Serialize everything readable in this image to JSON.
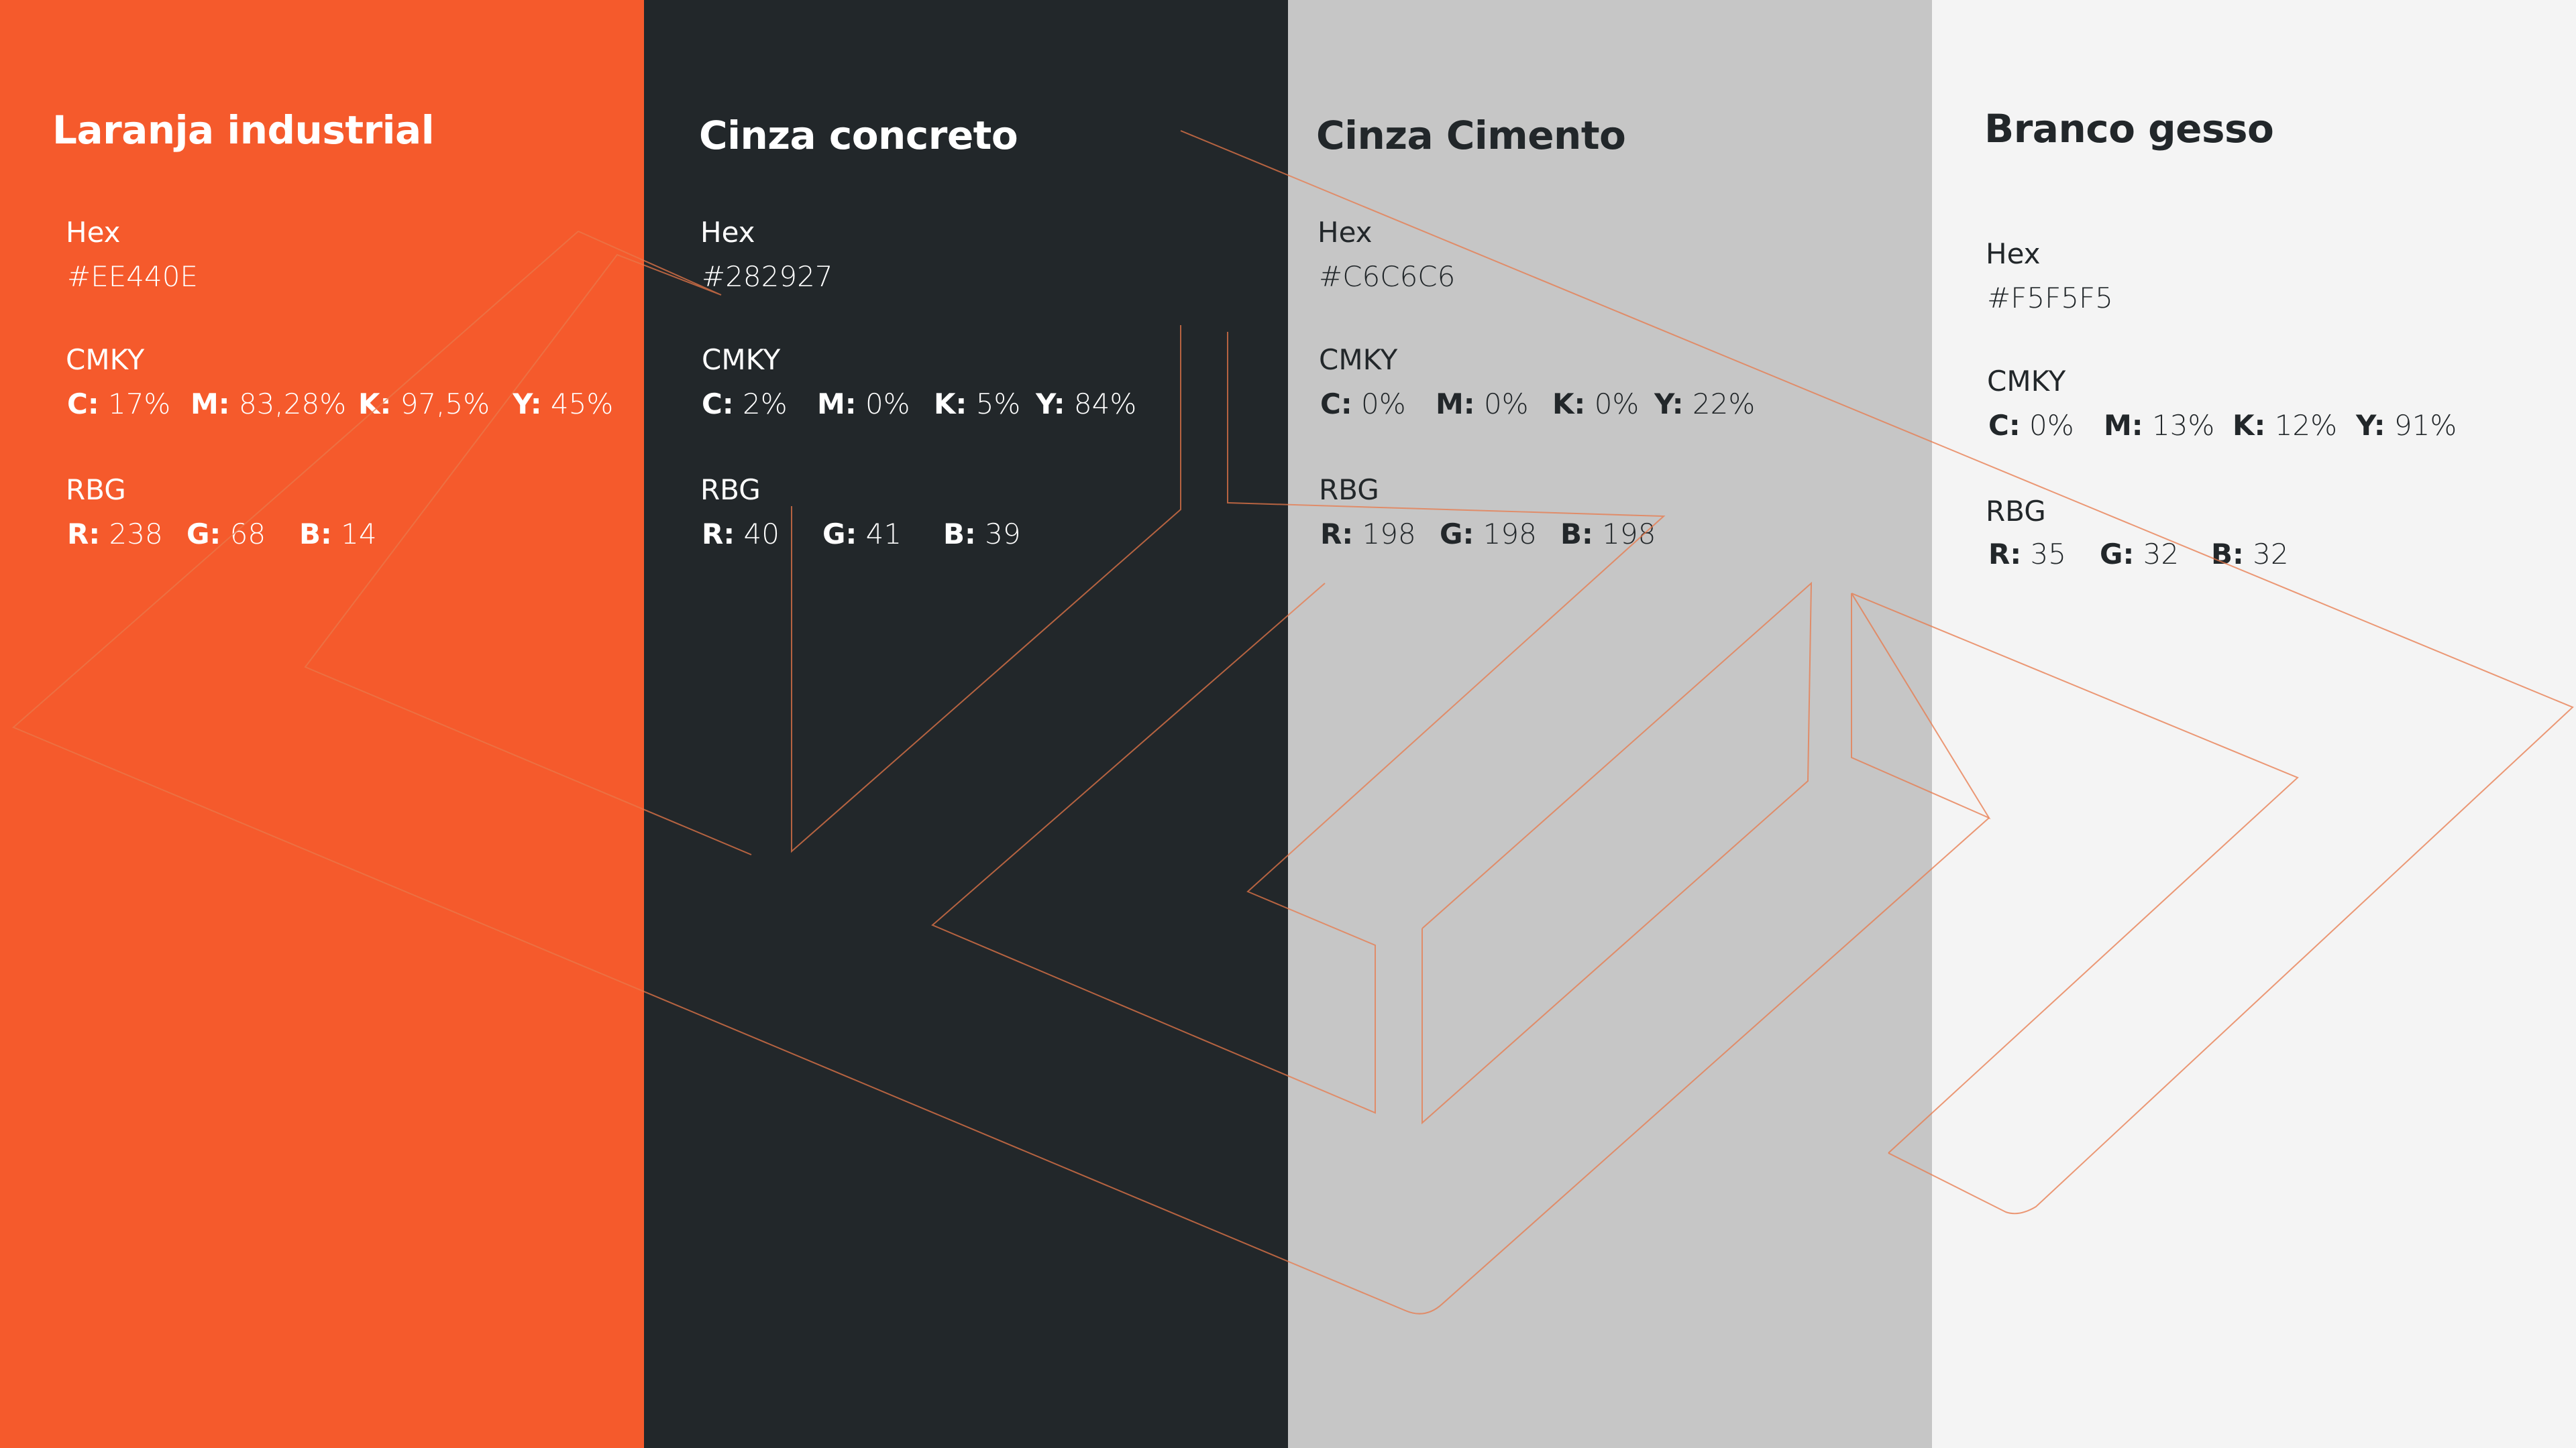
{
  "colors": [
    {
      "name": "Laranja industrial",
      "hex_label": "Hex",
      "hex_value": "#EE440E",
      "cmyk_label": "CMKY",
      "cmyk": [
        {
          "key": "C:",
          "val": "17%"
        },
        {
          "key": "M:",
          "val": "83,28%"
        },
        {
          "key": "K:",
          "val": "97,5%"
        },
        {
          "key": "Y:",
          "val": "45%"
        }
      ],
      "rgb_label": "RBG",
      "rgb": [
        {
          "key": "R:",
          "val": "238"
        },
        {
          "key": "G:",
          "val": "68"
        },
        {
          "key": "B:",
          "val": "14"
        }
      ],
      "swatch": "#F55A2C"
    },
    {
      "name": "Cinza concreto",
      "hex_label": "Hex",
      "hex_value": "#282927",
      "cmyk_label": "CMKY",
      "cmyk": [
        {
          "key": "C:",
          "val": "2%"
        },
        {
          "key": "M:",
          "val": "0%"
        },
        {
          "key": "K:",
          "val": "5%"
        },
        {
          "key": "Y:",
          "val": "84%"
        }
      ],
      "rgb_label": "RBG",
      "rgb": [
        {
          "key": "R:",
          "val": "40"
        },
        {
          "key": "G:",
          "val": "41"
        },
        {
          "key": "B:",
          "val": "39"
        }
      ],
      "swatch": "#22272A"
    },
    {
      "name": "Cinza Cimento",
      "hex_label": "Hex",
      "hex_value": "#C6C6C6",
      "cmyk_label": "CMKY",
      "cmyk": [
        {
          "key": "C:",
          "val": "0%"
        },
        {
          "key": "M:",
          "val": "0%"
        },
        {
          "key": "K:",
          "val": "0%"
        },
        {
          "key": "Y:",
          "val": "22%"
        }
      ],
      "rgb_label": "RBG",
      "rgb": [
        {
          "key": "R:",
          "val": "198"
        },
        {
          "key": "G:",
          "val": "198"
        },
        {
          "key": "B:",
          "val": "198"
        }
      ],
      "swatch": "#C6C6C6"
    },
    {
      "name": "Branco gesso",
      "hex_label": "Hex",
      "hex_value": "#F5F5F5",
      "cmyk_label": "CMKY",
      "cmyk": [
        {
          "key": "C:",
          "val": "0%"
        },
        {
          "key": "M:",
          "val": "13%"
        },
        {
          "key": "K:",
          "val": "12%"
        },
        {
          "key": "Y:",
          "val": "91%"
        }
      ],
      "rgb_label": "RBG",
      "rgb": [
        {
          "key": "R:",
          "val": "35"
        },
        {
          "key": "G:",
          "val": "32"
        },
        {
          "key": "B:",
          "val": "32"
        }
      ],
      "swatch": "#F4F4F4"
    }
  ],
  "logo_outline_color": "#E8784A"
}
